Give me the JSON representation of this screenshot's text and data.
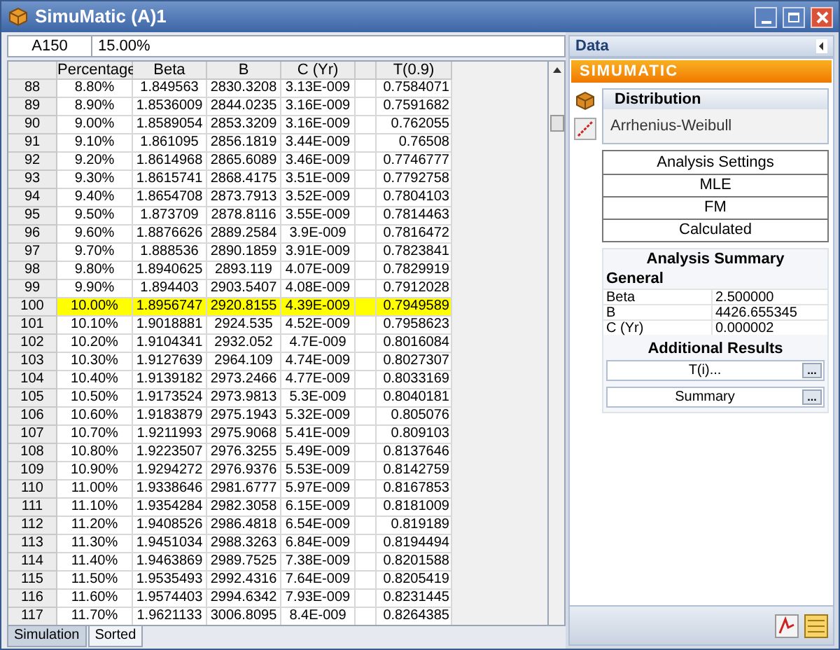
{
  "window": {
    "title": "SimuMatic (A)1"
  },
  "cell_ref": "A150",
  "formula_value": "15.00%",
  "table": {
    "columns": [
      "Percentage",
      "Beta",
      "B",
      "C (Yr)",
      "T(0.9)"
    ],
    "rows": [
      {
        "index": "88",
        "cells": [
          "8.80%",
          "1.849563",
          "2830.3208",
          "3.13E-009",
          "0.7584071"
        ],
        "selected": false
      },
      {
        "index": "89",
        "cells": [
          "8.90%",
          "1.8536009",
          "2844.0235",
          "3.16E-009",
          "0.7591682"
        ],
        "selected": false
      },
      {
        "index": "90",
        "cells": [
          "9.00%",
          "1.8589054",
          "2853.3209",
          "3.16E-009",
          "0.762055"
        ],
        "selected": false
      },
      {
        "index": "91",
        "cells": [
          "9.10%",
          "1.861095",
          "2856.1819",
          "3.44E-009",
          "0.76508"
        ],
        "selected": false
      },
      {
        "index": "92",
        "cells": [
          "9.20%",
          "1.8614968",
          "2865.6089",
          "3.46E-009",
          "0.7746777"
        ],
        "selected": false
      },
      {
        "index": "93",
        "cells": [
          "9.30%",
          "1.8615741",
          "2868.4175",
          "3.51E-009",
          "0.7792758"
        ],
        "selected": false
      },
      {
        "index": "94",
        "cells": [
          "9.40%",
          "1.8654708",
          "2873.7913",
          "3.52E-009",
          "0.7804103"
        ],
        "selected": false
      },
      {
        "index": "95",
        "cells": [
          "9.50%",
          "1.873709",
          "2878.8116",
          "3.55E-009",
          "0.7814463"
        ],
        "selected": false
      },
      {
        "index": "96",
        "cells": [
          "9.60%",
          "1.8876626",
          "2889.2584",
          "3.9E-009",
          "0.7816472"
        ],
        "selected": false
      },
      {
        "index": "97",
        "cells": [
          "9.70%",
          "1.888536",
          "2890.1859",
          "3.91E-009",
          "0.7823841"
        ],
        "selected": false
      },
      {
        "index": "98",
        "cells": [
          "9.80%",
          "1.8940625",
          "2893.119",
          "4.07E-009",
          "0.7829919"
        ],
        "selected": false
      },
      {
        "index": "99",
        "cells": [
          "9.90%",
          "1.894403",
          "2903.5407",
          "4.08E-009",
          "0.7912028"
        ],
        "selected": false
      },
      {
        "index": "100",
        "cells": [
          "10.00%",
          "1.8956747",
          "2920.8155",
          "4.39E-009",
          "0.7949589"
        ],
        "selected": true
      },
      {
        "index": "101",
        "cells": [
          "10.10%",
          "1.9018881",
          "2924.535",
          "4.52E-009",
          "0.7958623"
        ],
        "selected": false
      },
      {
        "index": "102",
        "cells": [
          "10.20%",
          "1.9104341",
          "2932.052",
          "4.7E-009",
          "0.8016084"
        ],
        "selected": false
      },
      {
        "index": "103",
        "cells": [
          "10.30%",
          "1.9127639",
          "2964.109",
          "4.74E-009",
          "0.8027307"
        ],
        "selected": false
      },
      {
        "index": "104",
        "cells": [
          "10.40%",
          "1.9139182",
          "2973.2466",
          "4.77E-009",
          "0.8033169"
        ],
        "selected": false
      },
      {
        "index": "105",
        "cells": [
          "10.50%",
          "1.9173524",
          "2973.9813",
          "5.3E-009",
          "0.8040181"
        ],
        "selected": false
      },
      {
        "index": "106",
        "cells": [
          "10.60%",
          "1.9183879",
          "2975.1943",
          "5.32E-009",
          "0.805076"
        ],
        "selected": false
      },
      {
        "index": "107",
        "cells": [
          "10.70%",
          "1.9211993",
          "2975.9068",
          "5.41E-009",
          "0.809103"
        ],
        "selected": false
      },
      {
        "index": "108",
        "cells": [
          "10.80%",
          "1.9223507",
          "2976.3255",
          "5.49E-009",
          "0.8137646"
        ],
        "selected": false
      },
      {
        "index": "109",
        "cells": [
          "10.90%",
          "1.9294272",
          "2976.9376",
          "5.53E-009",
          "0.8142759"
        ],
        "selected": false
      },
      {
        "index": "110",
        "cells": [
          "11.00%",
          "1.9338646",
          "2981.6777",
          "5.97E-009",
          "0.8167853"
        ],
        "selected": false
      },
      {
        "index": "111",
        "cells": [
          "11.10%",
          "1.9354284",
          "2982.3058",
          "6.15E-009",
          "0.8181009"
        ],
        "selected": false
      },
      {
        "index": "112",
        "cells": [
          "11.20%",
          "1.9408526",
          "2986.4818",
          "6.54E-009",
          "0.819189"
        ],
        "selected": false
      },
      {
        "index": "113",
        "cells": [
          "11.30%",
          "1.9451034",
          "2988.3263",
          "6.84E-009",
          "0.8194494"
        ],
        "selected": false
      },
      {
        "index": "114",
        "cells": [
          "11.40%",
          "1.9463869",
          "2989.7525",
          "7.38E-009",
          "0.8201588"
        ],
        "selected": false
      },
      {
        "index": "115",
        "cells": [
          "11.50%",
          "1.9535493",
          "2992.4316",
          "7.64E-009",
          "0.8205419"
        ],
        "selected": false
      },
      {
        "index": "116",
        "cells": [
          "11.60%",
          "1.9574403",
          "2994.6342",
          "7.93E-009",
          "0.8231445"
        ],
        "selected": false
      },
      {
        "index": "117",
        "cells": [
          "11.70%",
          "1.9621133",
          "3006.8095",
          "8.4E-009",
          "0.8264385"
        ],
        "selected": false
      }
    ]
  },
  "sheet_tabs": [
    {
      "label": "Simulation",
      "selected": true
    },
    {
      "label": "Sorted",
      "selected": false
    }
  ],
  "panel": {
    "title": "Data",
    "banner": "SIMUMATIC",
    "distribution": {
      "title": "Distribution",
      "value": "Arrhenius-Weibull"
    },
    "buttons": [
      "Analysis Settings",
      "MLE",
      "FM",
      "Calculated"
    ],
    "summary": {
      "title": "Analysis Summary",
      "group": "General",
      "rows": [
        {
          "label": "Beta",
          "value": "2.500000"
        },
        {
          "label": "B",
          "value": "4426.655345"
        },
        {
          "label": "C (Yr)",
          "value": "0.000002"
        }
      ]
    },
    "additional": {
      "title": "Additional Results",
      "items": [
        {
          "label": "T(i)...",
          "button": "..."
        },
        {
          "label": "Summary",
          "button": "..."
        }
      ]
    }
  }
}
